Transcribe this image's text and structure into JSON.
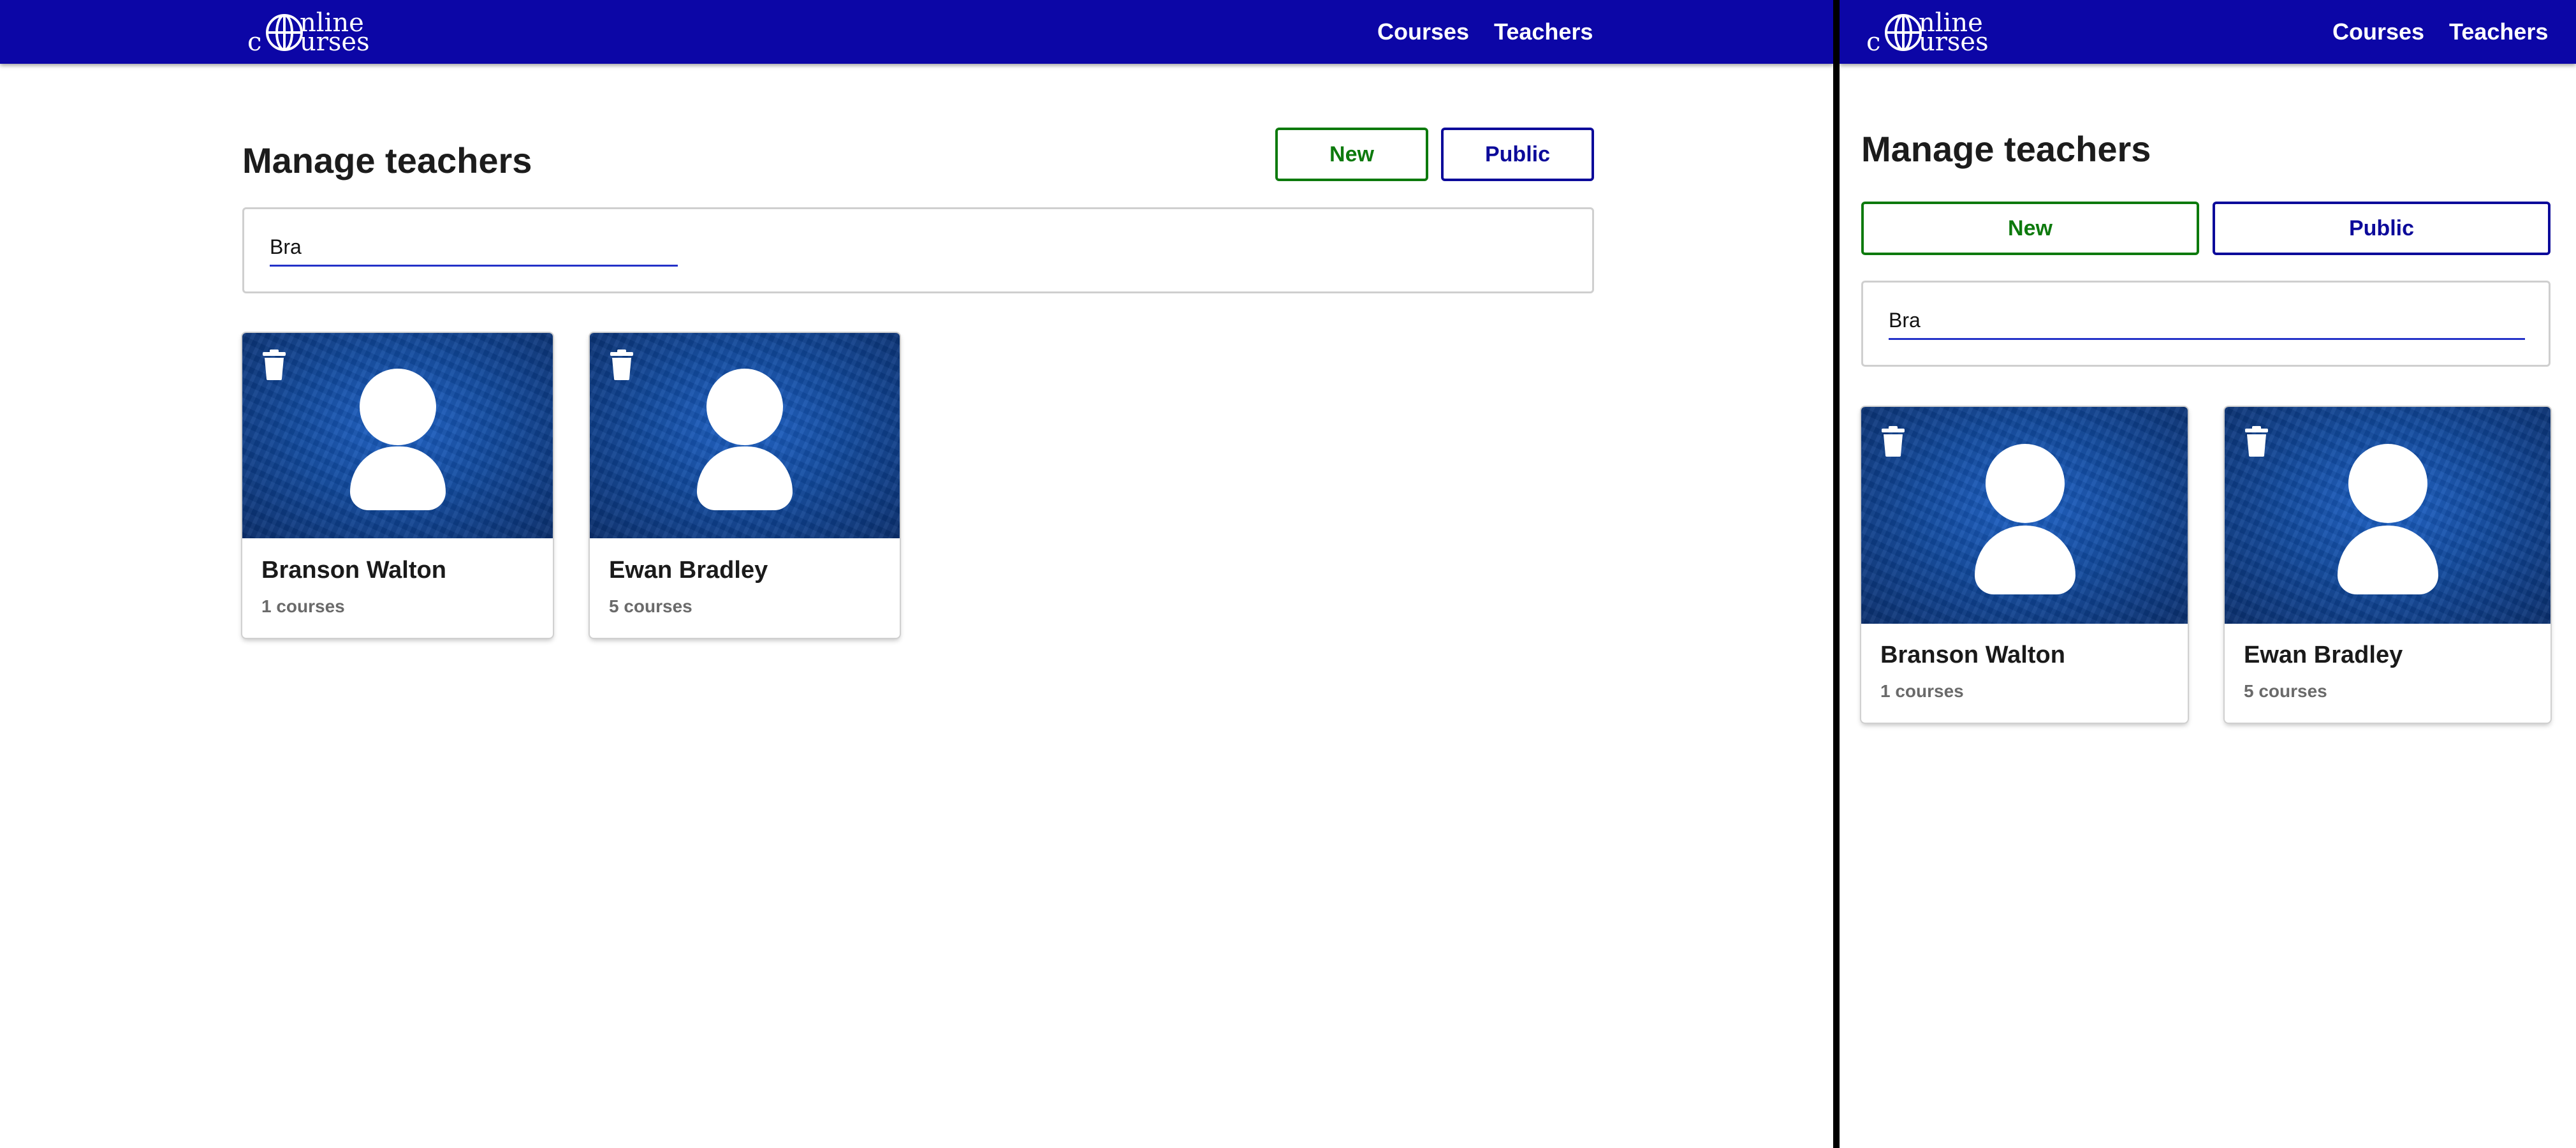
{
  "brand": {
    "logo_top": "nline",
    "logo_c": "c",
    "logo_bottom": "urses"
  },
  "nav": {
    "courses": "Courses",
    "teachers": "Teachers"
  },
  "page": {
    "title": "Manage teachers"
  },
  "actions": {
    "new_label": "New",
    "public_label": "Public"
  },
  "search": {
    "value": "Bra"
  },
  "teachers": [
    {
      "name": "Branson Walton",
      "courses": "1 courses"
    },
    {
      "name": "Ewan Bradley",
      "courses": "5 courses"
    }
  ],
  "colors": {
    "navbar": "#0c06a6",
    "new_accent": "#0d7a0d",
    "public_accent": "#0c0a9a",
    "search_underline": "#2432c8"
  },
  "icons": {
    "logo": "globe-icon",
    "delete": "trash-icon",
    "avatar": "user-icon"
  }
}
